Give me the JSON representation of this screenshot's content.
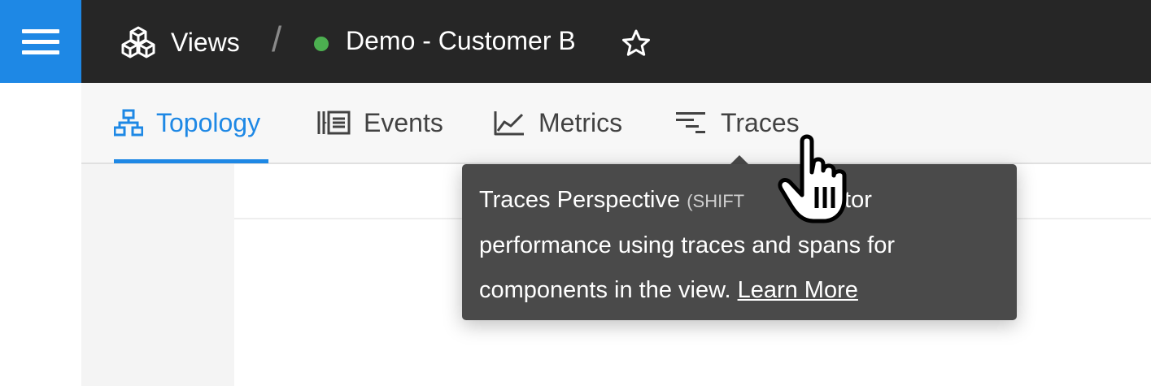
{
  "header": {
    "menu_icon": "hamburger-icon",
    "views_icon": "cubes-icon",
    "views_label": "Views",
    "separator": "/",
    "view_status_color": "#4caf50",
    "view_title": "Demo - Customer B",
    "favorite_icon": "star-outline-icon"
  },
  "tabs": [
    {
      "label": "Topology",
      "icon": "topology-icon",
      "active": true
    },
    {
      "label": "Events",
      "icon": "events-icon",
      "active": false
    },
    {
      "label": "Metrics",
      "icon": "metrics-chart-icon",
      "active": false
    },
    {
      "label": "Traces",
      "icon": "traces-icon",
      "active": false
    }
  ],
  "tooltip": {
    "title": "Traces Perspective",
    "shortcut": "(SHIFT",
    "text_after_cursor": "Monitor",
    "body": "performance using traces and spans for",
    "body_end": "components in the view.",
    "link": "Learn More"
  },
  "colors": {
    "accent": "#1e88e5",
    "topbar": "#262626",
    "tooltip_bg": "#4a4a4a"
  },
  "cursor_icon": "hand-pointer-cursor-icon"
}
